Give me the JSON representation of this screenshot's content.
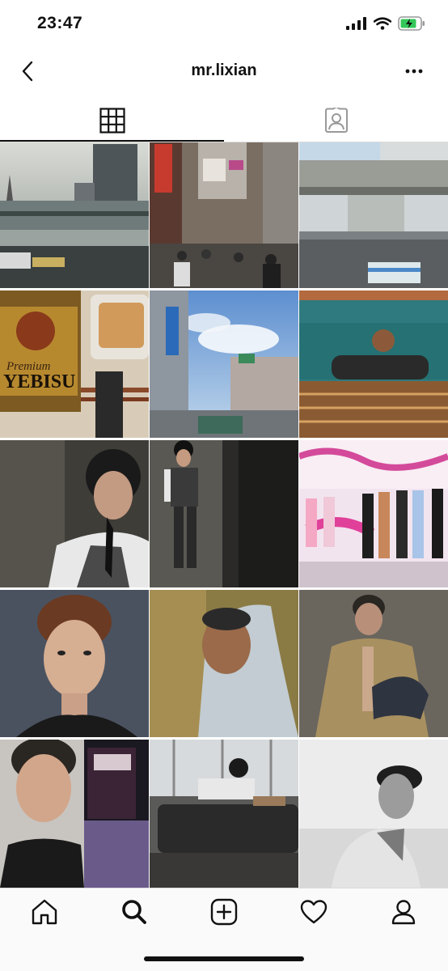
{
  "status_bar": {
    "time": "23:47"
  },
  "header": {
    "title": "mr.lixian"
  },
  "tabs": [
    {
      "name": "grid",
      "icon": "grid-icon"
    },
    {
      "name": "tagged",
      "icon": "tagged-person-icon"
    }
  ],
  "colors": {
    "text": "#111111",
    "divider": "#dbdbdb",
    "battery": "#34c759",
    "nav_bg": "#fafafa"
  },
  "photo_labels": {
    "beer_brand": "YEBISU",
    "beer_sub": "Premium"
  },
  "nav": [
    {
      "name": "home",
      "icon": "home-icon"
    },
    {
      "name": "search",
      "icon": "search-icon"
    },
    {
      "name": "add",
      "icon": "add-post-icon"
    },
    {
      "name": "activity",
      "icon": "heart-icon"
    },
    {
      "name": "profile",
      "icon": "profile-icon"
    }
  ]
}
